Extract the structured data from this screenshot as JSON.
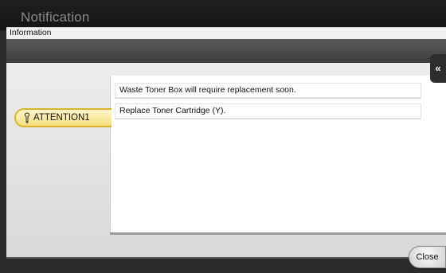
{
  "window": {
    "title": "Notification",
    "subtitle": "Information"
  },
  "tabs": [
    {
      "label": "ATTENTION1",
      "icon": "wrench-icon",
      "color": "#f5df7a"
    }
  ],
  "messages": [
    "Waste Toner Box will require replacement soon.",
    "Replace Toner Cartridge (Y)."
  ],
  "side_button": {
    "icon": "double-arrow-left-icon",
    "glyph": "«"
  },
  "footer": {
    "close_label": "Close"
  }
}
